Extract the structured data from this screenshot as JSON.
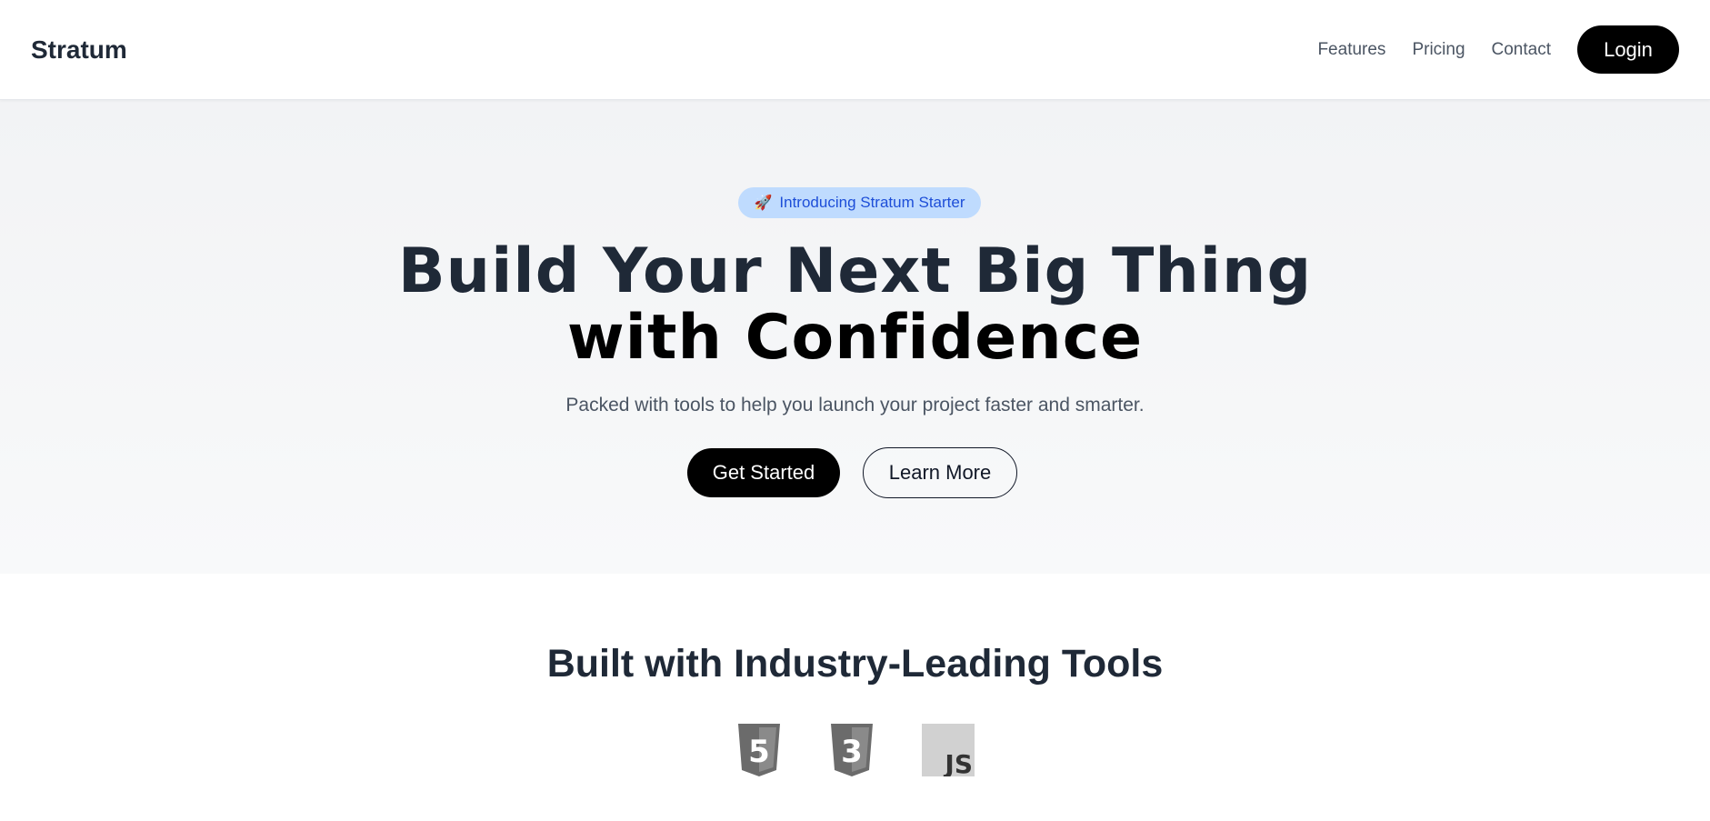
{
  "header": {
    "brand": "Stratum",
    "nav": [
      {
        "label": "Features"
      },
      {
        "label": "Pricing"
      },
      {
        "label": "Contact"
      }
    ],
    "login_label": "Login"
  },
  "hero": {
    "badge": {
      "icon": "rocket-icon",
      "text": "Introducing Stratum Starter"
    },
    "title_line1": "Build Your Next Big Thing",
    "title_line2": "with Confidence",
    "subtitle": "Packed with tools to help you launch your project faster and smarter.",
    "primary_cta": "Get Started",
    "secondary_cta": "Learn More"
  },
  "tools": {
    "title": "Built with Industry-Leading Tools",
    "logos": [
      {
        "icon": "html5-icon",
        "text": "5"
      },
      {
        "icon": "css3-icon",
        "text": "3"
      },
      {
        "icon": "javascript-icon",
        "text": "JS"
      }
    ]
  },
  "colors": {
    "accent_badge_bg": "#bfdbfe",
    "accent_badge_text": "#1d4ed8",
    "primary": "#000000",
    "heading": "#1f2937"
  }
}
